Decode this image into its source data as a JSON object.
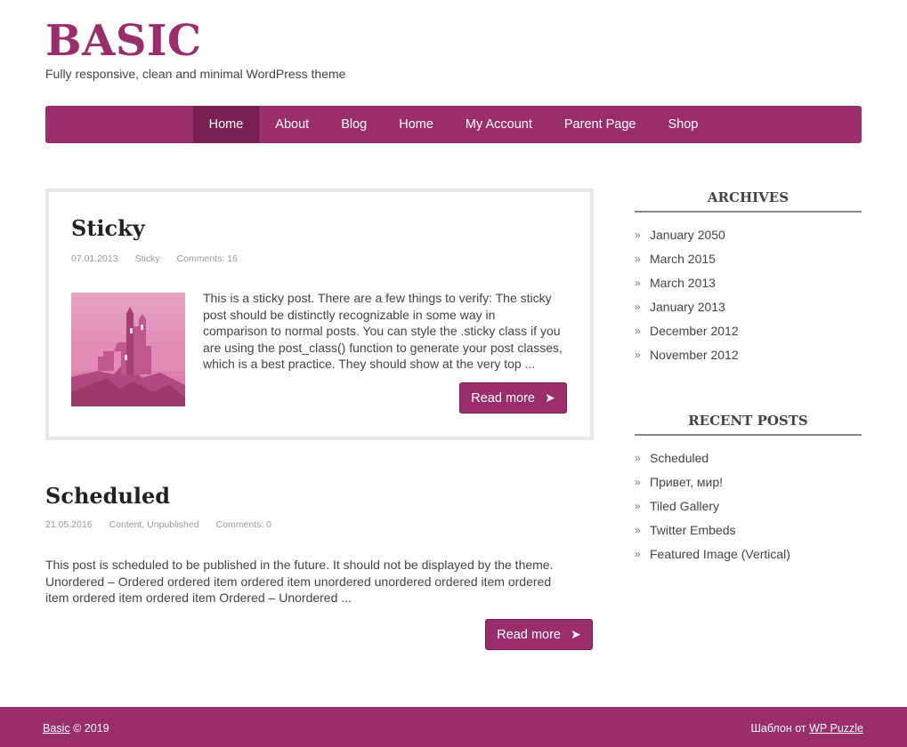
{
  "site": {
    "title": "BASIC",
    "description": "Fully responsive, clean and minimal WordPress theme"
  },
  "nav": {
    "items": [
      {
        "label": "Home",
        "active": true
      },
      {
        "label": "About"
      },
      {
        "label": "Blog"
      },
      {
        "label": "Home"
      },
      {
        "label": "My Account"
      },
      {
        "label": "Parent Page"
      },
      {
        "label": "Shop"
      }
    ]
  },
  "posts": [
    {
      "title": "Sticky",
      "date": "07.01.2013",
      "category": "Sticky",
      "comments": "Comments: 16",
      "excerpt_lines": [
        "This is a sticky post. There are a few things to verify: The sticky",
        "post should be distinctly recognizable in some way in",
        "comparison to normal posts. You can style the .sticky class if you",
        "are using the post_class() function to generate your post classes,",
        "which is a best practice. They should show at the very top ..."
      ],
      "read_more": "Read more",
      "arrow": "➤"
    },
    {
      "title": "Scheduled",
      "date": "21.05.2016",
      "category": "Content, Unpublished",
      "comments": "Comments: 0",
      "excerpt_lines": [
        "This post is scheduled to be published in the future. It should not be displayed by the theme.",
        "Unordered – Ordered ordered item ordered item unordered unordered ordered item ordered",
        "item ordered item ordered item Ordered – Unordered ..."
      ],
      "read_more": "Read more",
      "arrow": "➤"
    }
  ],
  "sidebar": {
    "archives": {
      "title": "ARCHIVES",
      "items": [
        "January 2050",
        "March 2015",
        "March 2013",
        "January 2013",
        "December 2012",
        "November 2012"
      ]
    },
    "recent": {
      "title": "RECENT POSTS",
      "items": [
        "Scheduled",
        "Привет, мир!",
        "Tiled Gallery",
        "Twitter Embeds",
        "Featured Image (Vertical)"
      ]
    },
    "bullet": "»"
  },
  "footer": {
    "brand_link": "Basic",
    "copyright": "© 2019",
    "credit_prefix": "Шаблон от",
    "credit_link": "WP Puzzle"
  },
  "colors": {
    "accent": "#9a2d6c",
    "accent_dark": "#7a1f52"
  },
  "icons": {
    "read_more": "arrow-right-icon",
    "list_bullet": "double-chevron-icon"
  }
}
